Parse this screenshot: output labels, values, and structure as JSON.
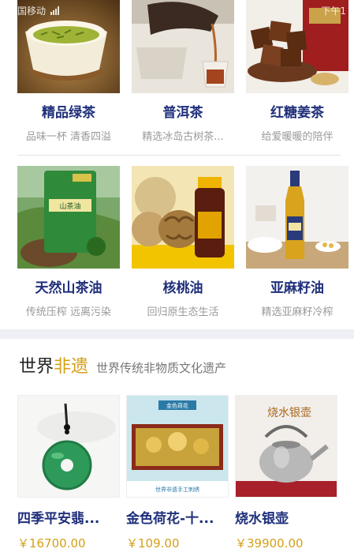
{
  "statusbar": {
    "carrier": "中国移动",
    "time": "下午1"
  },
  "row1": [
    {
      "title": "精品绿茶",
      "subtitle": "品味一杯 清香四溢"
    },
    {
      "title": "普洱茶",
      "subtitle": "精选冰岛古树茶..."
    },
    {
      "title": "红糖姜茶",
      "subtitle": "给爱暖暖的陪伴"
    }
  ],
  "row2": [
    {
      "title": "天然山茶油",
      "subtitle": "传统压榨 远离污染",
      "label": "山茶油"
    },
    {
      "title": "核桃油",
      "subtitle": "回归原生态生活"
    },
    {
      "title": "亚麻籽油",
      "subtitle": "精选亚麻籽冷榨"
    }
  ],
  "section": {
    "title_plain": "世界",
    "title_highlight": "非遗",
    "subtitle": "世界传统非物质文化遗产"
  },
  "row3": [
    {
      "title": "四季平安翡...",
      "price": "￥16700.00"
    },
    {
      "title": "金色荷花-十...",
      "price": "￥109.00",
      "banner": "金色荷花",
      "footer": "世界非遗手工刺绣"
    },
    {
      "title": "烧水银壶",
      "price": "￥39900.00",
      "banner": "烧水银壶"
    }
  ],
  "colors": {
    "title_blue": "#1f2f7a",
    "gold": "#d4a017",
    "muted": "#9a9a9a"
  }
}
